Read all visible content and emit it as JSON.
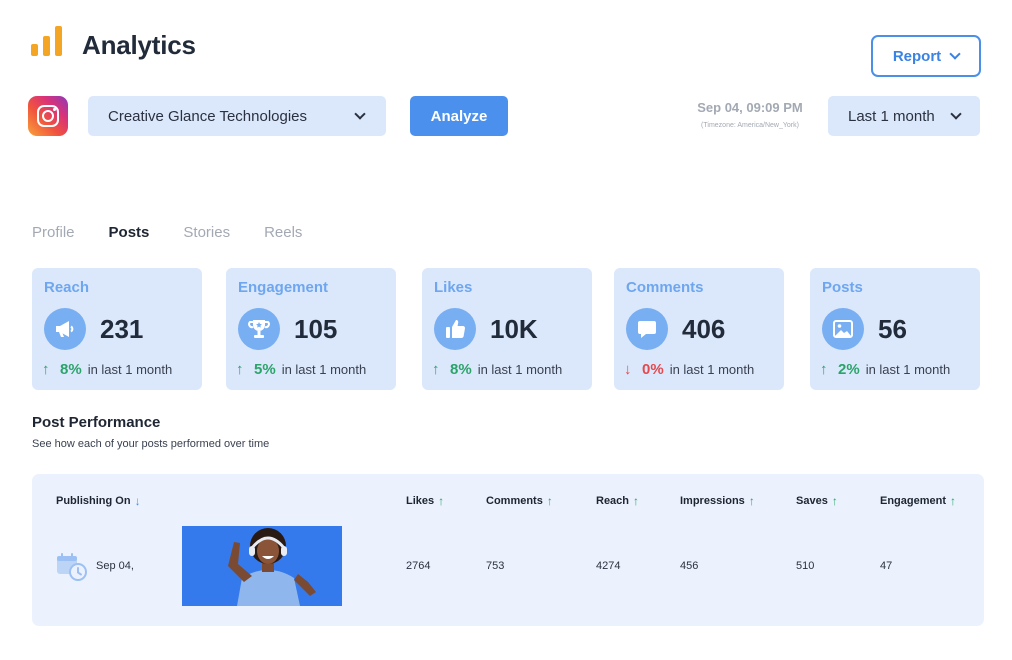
{
  "header": {
    "title": "Analytics",
    "report_label": "Report"
  },
  "controls": {
    "account": "Creative Glance Technologies",
    "analyze_label": "Analyze",
    "datetime": "Sep 04, 09:09 PM",
    "timezone": "(Timezone: America/New_York)",
    "range": "Last 1 month"
  },
  "tabs": [
    {
      "label": "Profile",
      "active": false
    },
    {
      "label": "Posts",
      "active": true
    },
    {
      "label": "Stories",
      "active": false
    },
    {
      "label": "Reels",
      "active": false
    }
  ],
  "cards": [
    {
      "label": "Reach",
      "value": "231",
      "trend": "up",
      "arrow": "↑",
      "pct": "8%",
      "period": "in last 1 month",
      "icon": "megaphone-icon"
    },
    {
      "label": "Engagement",
      "value": "105",
      "trend": "up",
      "arrow": "↑",
      "pct": "5%",
      "period": "in last 1 month",
      "icon": "trophy-icon"
    },
    {
      "label": "Likes",
      "value": "10K",
      "trend": "up",
      "arrow": "↑",
      "pct": "8%",
      "period": "in last 1 month",
      "icon": "thumbs-up-icon"
    },
    {
      "label": "Comments",
      "value": "406",
      "trend": "down",
      "arrow": "↓",
      "pct": "0%",
      "period": "in last 1 month",
      "icon": "comment-icon"
    },
    {
      "label": "Posts",
      "value": "56",
      "trend": "up",
      "arrow": "↑",
      "pct": "2%",
      "period": "in last 1 month",
      "icon": "image-icon"
    }
  ],
  "performance": {
    "title": "Post Performance",
    "subtitle": "See how each of your posts performed over time",
    "columns": {
      "publishing_on": "Publishing On",
      "likes": "Likes",
      "comments": "Comments",
      "reach": "Reach",
      "impressions": "Impressions",
      "saves": "Saves",
      "engagement": "Engagement"
    },
    "rows": [
      {
        "date": "Sep 04,",
        "likes": "2764",
        "comments": "753",
        "reach": "4274",
        "impressions": "456",
        "saves": "510",
        "engagement": "47"
      }
    ]
  },
  "colors": {
    "accent": "#4a90ec",
    "card_bg": "#dbe8fb",
    "table_bg": "#ebf2fd",
    "up": "#2ba36a",
    "down": "#e5484d",
    "logo": "#f5a524"
  }
}
